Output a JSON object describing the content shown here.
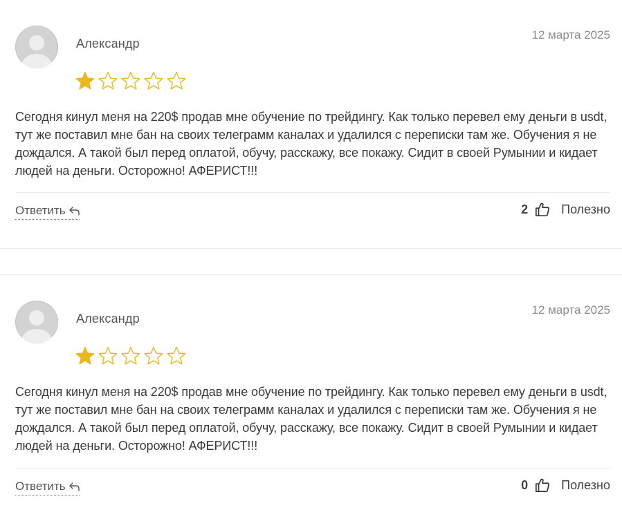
{
  "reviews": [
    {
      "author": "Александр",
      "date": "12 марта 2025",
      "rating": 1,
      "rating_max": 5,
      "text": "Сегодня кинул меня на 220$ продав мне обучение по трейдингу. Как только перевел ему деньги в usdt, тут же поставил мне бан на своих телеграмм каналах и удалился с переписки там же. Обучения я не дождался. А такой был перед оплатой, обучу, расскажу, все покажу. Сидит в своей Румынии и кидает людей на деньги. Осторожно! АФЕРИСТ!!!",
      "reply_label": "Ответить",
      "useful_count": "2",
      "useful_label": "Полезно"
    },
    {
      "author": "Александр",
      "date": "12 марта 2025",
      "rating": 1,
      "rating_max": 5,
      "text": "Сегодня кинул меня на 220$ продав мне обучение по трейдингу. Как только перевел ему деньги в usdt, тут же поставил мне бан на своих телеграмм каналах и удалился с переписки там же. Обучения я не дождался. А такой был перед оплатой, обучу, расскажу, все покажу. Сидит в своей Румынии и кидает людей на деньги. Осторожно! АФЕРИСТ!!!",
      "reply_label": "Ответить",
      "useful_count": "0",
      "useful_label": "Полезно"
    }
  ],
  "colors": {
    "star_filled": "#E8B918",
    "star_outline": "#E8B918",
    "avatar_bg": "#d3d3d3",
    "avatar_figure": "#eeeeee"
  },
  "icons": {
    "avatar": "user-placeholder-icon",
    "star": "star-icon",
    "reply": "reply-arrow-icon",
    "useful": "thumbs-up-icon"
  }
}
